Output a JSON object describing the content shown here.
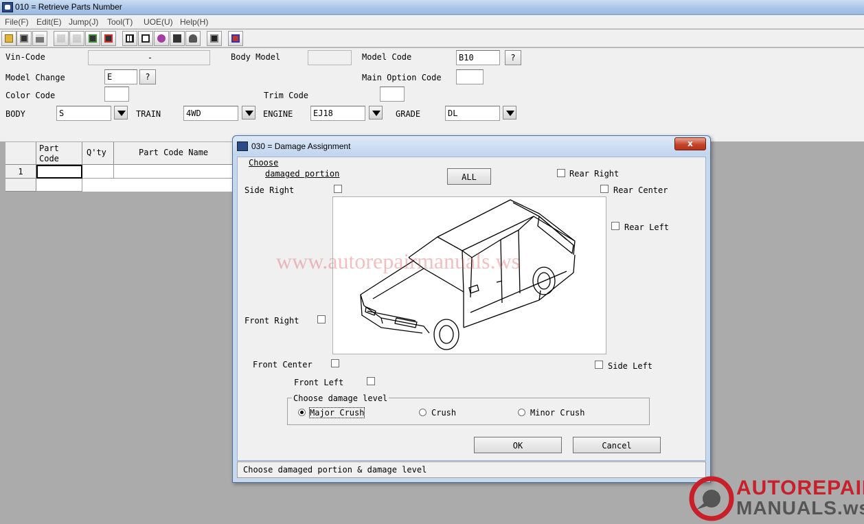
{
  "window": {
    "title": "010 = Retrieve Parts Number"
  },
  "menu": [
    "File(F)",
    "Edit(E)",
    "Jump(J)",
    "Tool(T)",
    "UOE(U)",
    "Help(H)"
  ],
  "toolbar_icons": [
    "open-icon",
    "save-icon",
    "print-icon",
    "numbering-icon",
    "check-icon",
    "order-icon",
    "report-icon",
    "grid-icon",
    "layout-icon",
    "user-icon",
    "font-icon",
    "person-icon",
    "copy-icon",
    "exit-icon"
  ],
  "form": {
    "vin_code": {
      "label": "Vin-Code",
      "value": "-"
    },
    "body_model": {
      "label": "Body Model",
      "value": ""
    },
    "model_code": {
      "label": "Model Code",
      "value": "B10"
    },
    "model_change": {
      "label": "Model Change",
      "value": "E"
    },
    "main_option_code": {
      "label": "Main Option Code",
      "value": ""
    },
    "color_code": {
      "label": "Color Code",
      "value": ""
    },
    "trim_code": {
      "label": "Trim Code",
      "value": ""
    },
    "body": {
      "label": "BODY",
      "value": "S"
    },
    "train": {
      "label": "TRAIN",
      "value": "4WD"
    },
    "engine": {
      "label": "ENGINE",
      "value": "EJ18"
    },
    "grade": {
      "label": "GRADE",
      "value": "DL"
    },
    "help_button": "?"
  },
  "grid": {
    "headers": {
      "part_code_line1": "Part",
      "part_code_line2": "Code",
      "qty": "Q'ty",
      "part_code_name": "Part Code Name"
    },
    "rows": [
      "1"
    ]
  },
  "dialog": {
    "title": "030 = Damage Assignment",
    "close": "x",
    "choose": "Choose",
    "damaged_portion": "damaged portion",
    "all_button": "ALL",
    "portions": {
      "rear_right": "Rear Right",
      "side_right": "Side Right",
      "rear_center": "Rear Center",
      "rear_left": "Rear Left",
      "front_right": "Front Right",
      "front_center": "Front Center",
      "side_left": "Side Left",
      "front_left": "Front Left"
    },
    "watermark": "www.autorepairmanuals.ws",
    "damage_level_legend": "Choose damage level",
    "levels": {
      "major": "Major Crush",
      "crush": "Crush",
      "minor": "Minor Crush"
    },
    "selected_level": "Major Crush",
    "ok": "OK",
    "cancel": "Cancel",
    "status": "Choose damaged portion & damage level"
  },
  "logo": {
    "line1": "AUTOREPAIR",
    "line2": "MANUALS.ws"
  },
  "colors": {
    "logo_red": "#c8202a",
    "logo_gray": "#555555",
    "close_red": "#c4452b"
  }
}
